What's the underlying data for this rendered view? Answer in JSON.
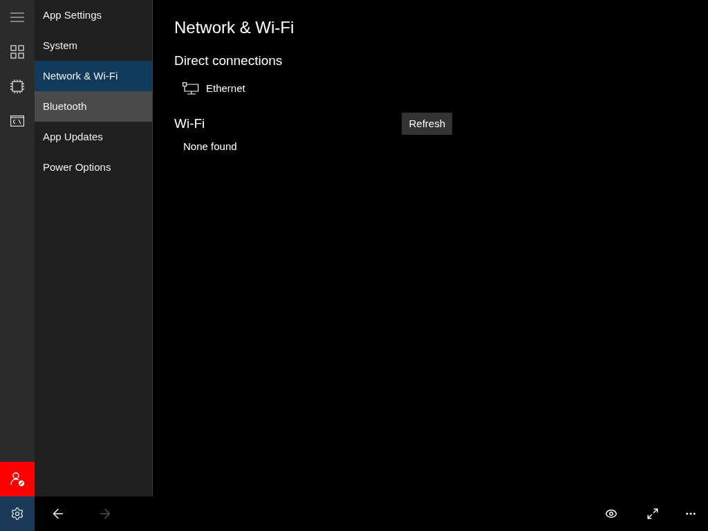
{
  "nav": {
    "items": [
      {
        "label": "App Settings",
        "selected": false,
        "hovered": false
      },
      {
        "label": "System",
        "selected": false,
        "hovered": false
      },
      {
        "label": "Network & Wi-Fi",
        "selected": true,
        "hovered": false
      },
      {
        "label": "Bluetooth",
        "selected": false,
        "hovered": true
      },
      {
        "label": "App Updates",
        "selected": false,
        "hovered": false
      },
      {
        "label": "Power Options",
        "selected": false,
        "hovered": false
      }
    ]
  },
  "page": {
    "title": "Network & Wi-Fi",
    "direct": {
      "heading": "Direct connections",
      "connections": [
        "Ethernet"
      ]
    },
    "wifi": {
      "heading": "Wi-Fi",
      "refresh": "Refresh",
      "status": "None found"
    }
  },
  "toolbar": {
    "back_disabled": false,
    "forward_disabled": true
  }
}
